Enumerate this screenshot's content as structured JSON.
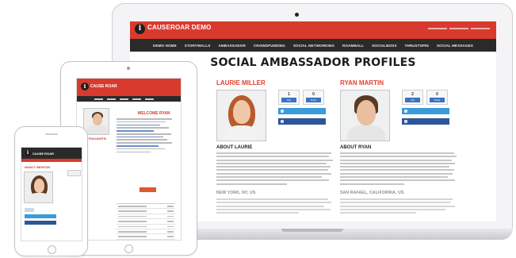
{
  "colors": {
    "brand_red": "#d93a2e",
    "nav_dark": "#2a2a2a",
    "twitter": "#3a9bd9",
    "facebook": "#2f5597"
  },
  "site": {
    "brand": "CAUSEROAR DEMO",
    "nav": [
      "DEMO HOME",
      "STORYWALLS",
      "AMBASSADOR",
      "CROWDFUNDING",
      "SOCIAL NETWORKING",
      "ROAMBALL",
      "SOCIALBOSS",
      "THRUSTSPIN",
      "SOCIAL MESSAGES"
    ],
    "page_title": "SOCIAL AMBASSADOR PROFILES"
  },
  "profiles": [
    {
      "name": "LAURIE MILLER",
      "count_a": "1",
      "count_b": "0",
      "btn_a": "Like",
      "btn_b": "Posts",
      "about": "ABOUT LAURIE",
      "location": "NEW YORK, NY, US"
    },
    {
      "name": "RYAN MARTIN",
      "count_a": "2",
      "count_b": "0",
      "btn_a": "Like",
      "btn_b": "Posts",
      "about": "ABOUT RYAN",
      "location": "SAN RAFAEL, CALIFORNIA, US"
    }
  ],
  "tablet": {
    "brand": "CAUSE ROAR",
    "welcome": "WELCOME RYAN",
    "name_line1": "RYAN MARTIN"
  },
  "phone": {
    "brand": "CAUSE ROAR",
    "name": "NANCY BENTON"
  }
}
